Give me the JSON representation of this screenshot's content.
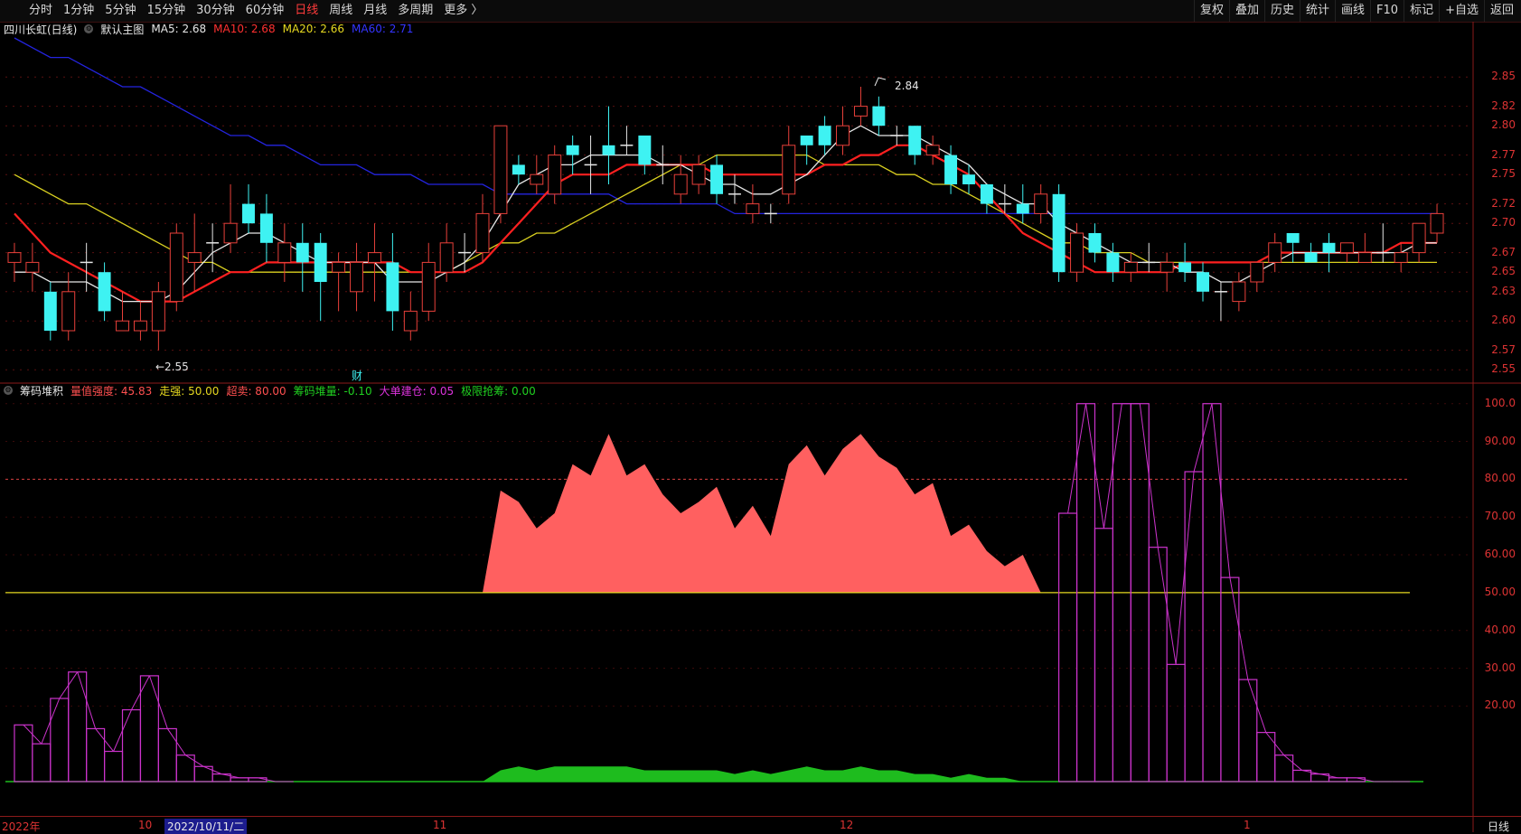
{
  "periods": {
    "tabs": [
      "分时",
      "1分钟",
      "5分钟",
      "15分钟",
      "30分钟",
      "60分钟",
      "日线",
      "周线",
      "月线",
      "多周期",
      "更多 〉"
    ],
    "active_index": 6
  },
  "tools": [
    "复权",
    "叠加",
    "历史",
    "统计",
    "画线",
    "F10",
    "标记",
    "+自选",
    "返回"
  ],
  "main_legend": {
    "stock_name": "四川长虹(日线)",
    "preset": "默认主图",
    "ma5": "MA5: 2.68",
    "ma10": "MA10: 2.68",
    "ma20": "MA20: 2.66",
    "ma60": "MA60: 2.71"
  },
  "sub_legend": {
    "indicator": "筹码堆积",
    "i1": "量值强度: 45.83",
    "i2": "走强: 50.00",
    "i3": "超卖: 80.00",
    "i4": "筹码堆量: -0.10",
    "i5": "大单建仓: 0.05",
    "i6": "极限抢筹: 0.00"
  },
  "annotations": {
    "high": "2.84",
    "low": "←2.55",
    "cai": "财"
  },
  "price_axis": [
    "2.85",
    "2.82",
    "2.80",
    "2.77",
    "2.75",
    "2.72",
    "2.70",
    "2.67",
    "2.65",
    "2.63",
    "2.60",
    "2.57",
    "2.55"
  ],
  "sub_axis": [
    "100.0",
    "90.00",
    "80.00",
    "70.00",
    "60.00",
    "50.00",
    "40.00",
    "30.00",
    "20.00"
  ],
  "dates": {
    "d1": "2022年",
    "d2": "10",
    "d3": "2022/10/11/二",
    "d4": "11",
    "d5": "12",
    "d6": "1",
    "period": "日线"
  },
  "colors": {
    "up": "#e8403a",
    "down": "#3ef2f2",
    "ma5": "#e6e6e6",
    "ma10": "#ff2020",
    "ma20": "#d9d020",
    "ma60": "#2424e0",
    "area": "#ff6060",
    "volume": "#1ebc1e",
    "purple": "#cc33cc"
  },
  "chart_data": {
    "type": "candlestick",
    "candles": [
      [
        2.66,
        2.67,
        2.68,
        2.64
      ],
      [
        2.65,
        2.66,
        2.68,
        2.63
      ],
      [
        2.63,
        2.59,
        2.64,
        2.58
      ],
      [
        2.59,
        2.63,
        2.65,
        2.58
      ],
      [
        2.66,
        2.66,
        2.68,
        2.63
      ],
      [
        2.65,
        2.61,
        2.66,
        2.6
      ],
      [
        2.59,
        2.6,
        2.63,
        2.59
      ],
      [
        2.59,
        2.6,
        2.62,
        2.58
      ],
      [
        2.59,
        2.63,
        2.64,
        2.57
      ],
      [
        2.62,
        2.69,
        2.7,
        2.61
      ],
      [
        2.66,
        2.67,
        2.71,
        2.63
      ],
      [
        2.68,
        2.68,
        2.7,
        2.65
      ],
      [
        2.68,
        2.7,
        2.74,
        2.67
      ],
      [
        2.72,
        2.7,
        2.74,
        2.69
      ],
      [
        2.71,
        2.68,
        2.73,
        2.66
      ],
      [
        2.66,
        2.68,
        2.7,
        2.64
      ],
      [
        2.68,
        2.66,
        2.7,
        2.63
      ],
      [
        2.68,
        2.64,
        2.69,
        2.6
      ],
      [
        2.65,
        2.66,
        2.67,
        2.61
      ],
      [
        2.63,
        2.66,
        2.68,
        2.61
      ],
      [
        2.66,
        2.67,
        2.7,
        2.62
      ],
      [
        2.66,
        2.61,
        2.69,
        2.59
      ],
      [
        2.59,
        2.61,
        2.63,
        2.58
      ],
      [
        2.61,
        2.66,
        2.68,
        2.6
      ],
      [
        2.65,
        2.68,
        2.7,
        2.64
      ],
      [
        2.67,
        2.67,
        2.69,
        2.65
      ],
      [
        2.67,
        2.71,
        2.73,
        2.66
      ],
      [
        2.71,
        2.8,
        2.8,
        2.7
      ],
      [
        2.76,
        2.75,
        2.77,
        2.74
      ],
      [
        2.74,
        2.75,
        2.77,
        2.73
      ],
      [
        2.73,
        2.77,
        2.78,
        2.72
      ],
      [
        2.78,
        2.77,
        2.79,
        2.75
      ],
      [
        2.76,
        2.76,
        2.79,
        2.73
      ],
      [
        2.78,
        2.77,
        2.82,
        2.74
      ],
      [
        2.78,
        2.78,
        2.8,
        2.77
      ],
      [
        2.79,
        2.76,
        2.79,
        2.75
      ],
      [
        2.76,
        2.76,
        2.78,
        2.74
      ],
      [
        2.73,
        2.75,
        2.77,
        2.72
      ],
      [
        2.74,
        2.76,
        2.77,
        2.73
      ],
      [
        2.76,
        2.73,
        2.77,
        2.72
      ],
      [
        2.73,
        2.73,
        2.75,
        2.72
      ],
      [
        2.71,
        2.72,
        2.74,
        2.7
      ],
      [
        2.71,
        2.71,
        2.72,
        2.7
      ],
      [
        2.73,
        2.78,
        2.8,
        2.72
      ],
      [
        2.79,
        2.78,
        2.79,
        2.76
      ],
      [
        2.8,
        2.78,
        2.81,
        2.77
      ],
      [
        2.78,
        2.8,
        2.82,
        2.77
      ],
      [
        2.81,
        2.82,
        2.84,
        2.8
      ],
      [
        2.82,
        2.8,
        2.83,
        2.79
      ],
      [
        2.79,
        2.79,
        2.8,
        2.78
      ],
      [
        2.8,
        2.77,
        2.8,
        2.76
      ],
      [
        2.77,
        2.78,
        2.79,
        2.76
      ],
      [
        2.77,
        2.74,
        2.78,
        2.73
      ],
      [
        2.75,
        2.74,
        2.76,
        2.73
      ],
      [
        2.74,
        2.72,
        2.74,
        2.71
      ],
      [
        2.72,
        2.72,
        2.74,
        2.71
      ],
      [
        2.72,
        2.71,
        2.74,
        2.7
      ],
      [
        2.71,
        2.73,
        2.74,
        2.7
      ],
      [
        2.73,
        2.65,
        2.74,
        2.64
      ],
      [
        2.65,
        2.69,
        2.7,
        2.64
      ],
      [
        2.69,
        2.67,
        2.7,
        2.66
      ],
      [
        2.67,
        2.65,
        2.68,
        2.64
      ],
      [
        2.65,
        2.66,
        2.67,
        2.64
      ],
      [
        2.66,
        2.66,
        2.68,
        2.65
      ],
      [
        2.65,
        2.66,
        2.67,
        2.63
      ],
      [
        2.66,
        2.65,
        2.68,
        2.64
      ],
      [
        2.65,
        2.63,
        2.66,
        2.62
      ],
      [
        2.63,
        2.63,
        2.64,
        2.6
      ],
      [
        2.62,
        2.64,
        2.65,
        2.61
      ],
      [
        2.64,
        2.66,
        2.66,
        2.63
      ],
      [
        2.66,
        2.68,
        2.69,
        2.65
      ],
      [
        2.69,
        2.68,
        2.69,
        2.66
      ],
      [
        2.67,
        2.66,
        2.68,
        2.66
      ],
      [
        2.68,
        2.67,
        2.69,
        2.65
      ],
      [
        2.67,
        2.68,
        2.68,
        2.66
      ],
      [
        2.66,
        2.67,
        2.69,
        2.66
      ],
      [
        2.67,
        2.67,
        2.7,
        2.66
      ],
      [
        2.66,
        2.67,
        2.68,
        2.65
      ],
      [
        2.67,
        2.7,
        2.7,
        2.66
      ],
      [
        2.69,
        2.71,
        2.72,
        2.68
      ]
    ],
    "ma5": [
      2.65,
      2.65,
      2.64,
      2.64,
      2.64,
      2.63,
      2.62,
      2.62,
      2.62,
      2.63,
      2.65,
      2.67,
      2.68,
      2.69,
      2.69,
      2.68,
      2.67,
      2.66,
      2.66,
      2.66,
      2.66,
      2.64,
      2.64,
      2.64,
      2.65,
      2.66,
      2.68,
      2.71,
      2.74,
      2.75,
      2.76,
      2.76,
      2.77,
      2.77,
      2.77,
      2.77,
      2.76,
      2.76,
      2.75,
      2.74,
      2.74,
      2.73,
      2.73,
      2.74,
      2.75,
      2.77,
      2.79,
      2.8,
      2.79,
      2.79,
      2.79,
      2.78,
      2.77,
      2.76,
      2.74,
      2.73,
      2.72,
      2.72,
      2.7,
      2.69,
      2.68,
      2.67,
      2.66,
      2.66,
      2.66,
      2.65,
      2.65,
      2.64,
      2.64,
      2.65,
      2.66,
      2.67,
      2.67,
      2.67,
      2.67,
      2.67,
      2.67,
      2.67,
      2.68,
      2.68
    ],
    "ma10": [
      2.71,
      2.69,
      2.67,
      2.66,
      2.65,
      2.64,
      2.63,
      2.62,
      2.62,
      2.62,
      2.63,
      2.64,
      2.65,
      2.65,
      2.66,
      2.66,
      2.66,
      2.66,
      2.66,
      2.66,
      2.66,
      2.66,
      2.65,
      2.65,
      2.65,
      2.65,
      2.66,
      2.68,
      2.7,
      2.72,
      2.74,
      2.75,
      2.75,
      2.75,
      2.76,
      2.76,
      2.76,
      2.76,
      2.76,
      2.75,
      2.75,
      2.75,
      2.75,
      2.75,
      2.75,
      2.76,
      2.76,
      2.77,
      2.77,
      2.78,
      2.78,
      2.77,
      2.76,
      2.75,
      2.73,
      2.71,
      2.69,
      2.68,
      2.67,
      2.66,
      2.65,
      2.65,
      2.65,
      2.65,
      2.65,
      2.66,
      2.66,
      2.66,
      2.66,
      2.66,
      2.67,
      2.67,
      2.67,
      2.67,
      2.67,
      2.67,
      2.67,
      2.68,
      2.68,
      2.68
    ],
    "ma20": [
      2.75,
      2.74,
      2.73,
      2.72,
      2.72,
      2.71,
      2.7,
      2.69,
      2.68,
      2.67,
      2.66,
      2.66,
      2.65,
      2.65,
      2.65,
      2.65,
      2.65,
      2.65,
      2.65,
      2.65,
      2.65,
      2.65,
      2.65,
      2.65,
      2.65,
      2.66,
      2.67,
      2.68,
      2.68,
      2.69,
      2.69,
      2.7,
      2.71,
      2.72,
      2.73,
      2.74,
      2.75,
      2.76,
      2.76,
      2.77,
      2.77,
      2.77,
      2.77,
      2.77,
      2.77,
      2.76,
      2.76,
      2.76,
      2.76,
      2.75,
      2.75,
      2.74,
      2.74,
      2.73,
      2.72,
      2.71,
      2.7,
      2.69,
      2.68,
      2.68,
      2.67,
      2.67,
      2.67,
      2.66,
      2.66,
      2.66,
      2.66,
      2.66,
      2.66,
      2.66,
      2.66,
      2.66,
      2.66,
      2.66,
      2.66,
      2.66,
      2.66,
      2.66,
      2.66,
      2.66
    ],
    "ma60": [
      2.89,
      2.88,
      2.87,
      2.87,
      2.86,
      2.85,
      2.84,
      2.84,
      2.83,
      2.82,
      2.81,
      2.8,
      2.79,
      2.79,
      2.78,
      2.78,
      2.77,
      2.76,
      2.76,
      2.76,
      2.75,
      2.75,
      2.75,
      2.74,
      2.74,
      2.74,
      2.74,
      2.73,
      2.73,
      2.73,
      2.73,
      2.73,
      2.73,
      2.73,
      2.72,
      2.72,
      2.72,
      2.72,
      2.72,
      2.72,
      2.71,
      2.71,
      2.71,
      2.71,
      2.71,
      2.71,
      2.71,
      2.71,
      2.71,
      2.71,
      2.71,
      2.71,
      2.71,
      2.71,
      2.71,
      2.71,
      2.71,
      2.71,
      2.71,
      2.71,
      2.71,
      2.71,
      2.71,
      2.71,
      2.71,
      2.71,
      2.71,
      2.71,
      2.71,
      2.71,
      2.71,
      2.71,
      2.71,
      2.71,
      2.71,
      2.71,
      2.71,
      2.71,
      2.71,
      2.71
    ],
    "y_range": [
      2.54,
      2.89
    ],
    "sub_range": [
      0,
      104
    ],
    "area": [
      50,
      50,
      50,
      50,
      50,
      50,
      50,
      50,
      50,
      50,
      50,
      50,
      50,
      50,
      50,
      50,
      50,
      50,
      50,
      50,
      50,
      50,
      50,
      50,
      50,
      50,
      50,
      77,
      74,
      67,
      71,
      84,
      81,
      92,
      81,
      84,
      76,
      71,
      74,
      78,
      67,
      73,
      65,
      84,
      89,
      81,
      88,
      92,
      86,
      83,
      76,
      79,
      65,
      68,
      61,
      57,
      60,
      50
    ],
    "volume": [
      0,
      0,
      0,
      0,
      0,
      0,
      0,
      0,
      0,
      0,
      0,
      0,
      0,
      0,
      0,
      0,
      0,
      0,
      0,
      0,
      0,
      0,
      0,
      0,
      0,
      0,
      0,
      3,
      4,
      3,
      4,
      4,
      4,
      4,
      4,
      3,
      3,
      3,
      3,
      3,
      2,
      3,
      2,
      3,
      4,
      3,
      3,
      4,
      3,
      3,
      2,
      2,
      1,
      2,
      1,
      1,
      0,
      0
    ],
    "purple_left": [
      15,
      10,
      22,
      29,
      14,
      8,
      19,
      28,
      14,
      7,
      4,
      2,
      1,
      1,
      0,
      0
    ],
    "purple_right": [
      71,
      100,
      67,
      100,
      100,
      62,
      31,
      82,
      100,
      54,
      27,
      13,
      7,
      3,
      2,
      1,
      1,
      0,
      0,
      0
    ]
  }
}
